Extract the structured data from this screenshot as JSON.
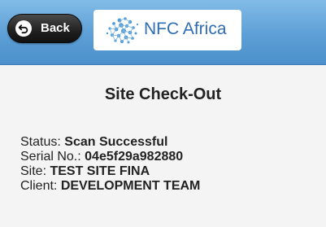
{
  "header": {
    "back_label": "Back",
    "logo_text": "NFC Africa",
    "background_color": "#5c9fd6",
    "icons": {
      "back": "back-arrow-icon",
      "logo": "globe-network-icon"
    }
  },
  "page": {
    "title": "Site Check-Out"
  },
  "info": {
    "status": {
      "label": "Status:",
      "value": "Scan Successful"
    },
    "serial": {
      "label": "Serial No.:",
      "value": "04e5f29a982880"
    },
    "site": {
      "label": "Site:",
      "value": "TEST SITE FINA"
    },
    "client": {
      "label": "Client:",
      "value": "DEVELOPMENT TEAM"
    }
  }
}
